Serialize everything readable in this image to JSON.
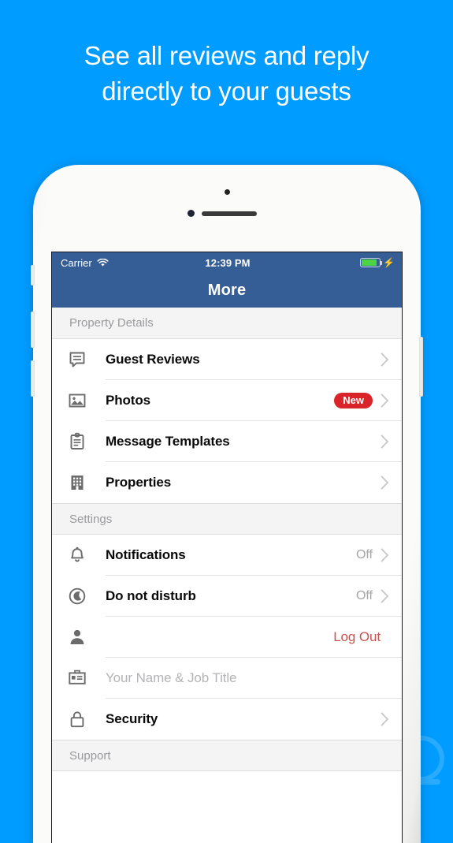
{
  "headline": {
    "line1": "See all reviews and reply",
    "line2": "directly to your guests"
  },
  "colors": {
    "background": "#009cff",
    "navbar": "#365e96",
    "badge_red": "#d9252a",
    "logout_red": "#c9534f",
    "battery_green": "#4cd445",
    "section_bg": "#f4f4f5"
  },
  "status_bar": {
    "carrier": "Carrier",
    "wifi_icon": "wifi-icon",
    "time": "12:39 PM",
    "battery_icon": "battery-icon",
    "charging_icon": "charging-bolt-icon"
  },
  "navbar": {
    "title": "More"
  },
  "sections": [
    {
      "header": "Property Details",
      "rows": [
        {
          "label": "Guest Reviews",
          "icon": "chat-bubble-icon",
          "value": "",
          "badge": "",
          "chevron": true,
          "style": "normal"
        },
        {
          "label": "Photos",
          "icon": "photo-icon",
          "value": "",
          "badge": "New",
          "chevron": true,
          "style": "normal"
        },
        {
          "label": "Message Templates",
          "icon": "clipboard-icon",
          "value": "",
          "badge": "",
          "chevron": true,
          "style": "normal"
        },
        {
          "label": "Properties",
          "icon": "building-icon",
          "value": "",
          "badge": "",
          "chevron": true,
          "style": "normal"
        }
      ]
    },
    {
      "header": "Settings",
      "rows": [
        {
          "label": "Notifications",
          "icon": "bell-icon",
          "value": "Off",
          "badge": "",
          "chevron": true,
          "style": "normal"
        },
        {
          "label": "Do not disturb",
          "icon": "moon-icon",
          "value": "Off",
          "badge": "",
          "chevron": true,
          "style": "normal"
        },
        {
          "label": "Log Out",
          "icon": "person-icon",
          "value": "",
          "badge": "",
          "chevron": false,
          "style": "danger"
        },
        {
          "label": "Your Name & Job Title",
          "icon": "id-card-icon",
          "value": "",
          "badge": "",
          "chevron": false,
          "style": "placeholder"
        },
        {
          "label": "Security",
          "icon": "lock-icon",
          "value": "",
          "badge": "",
          "chevron": true,
          "style": "normal"
        }
      ]
    },
    {
      "header": "Support",
      "rows": []
    }
  ]
}
